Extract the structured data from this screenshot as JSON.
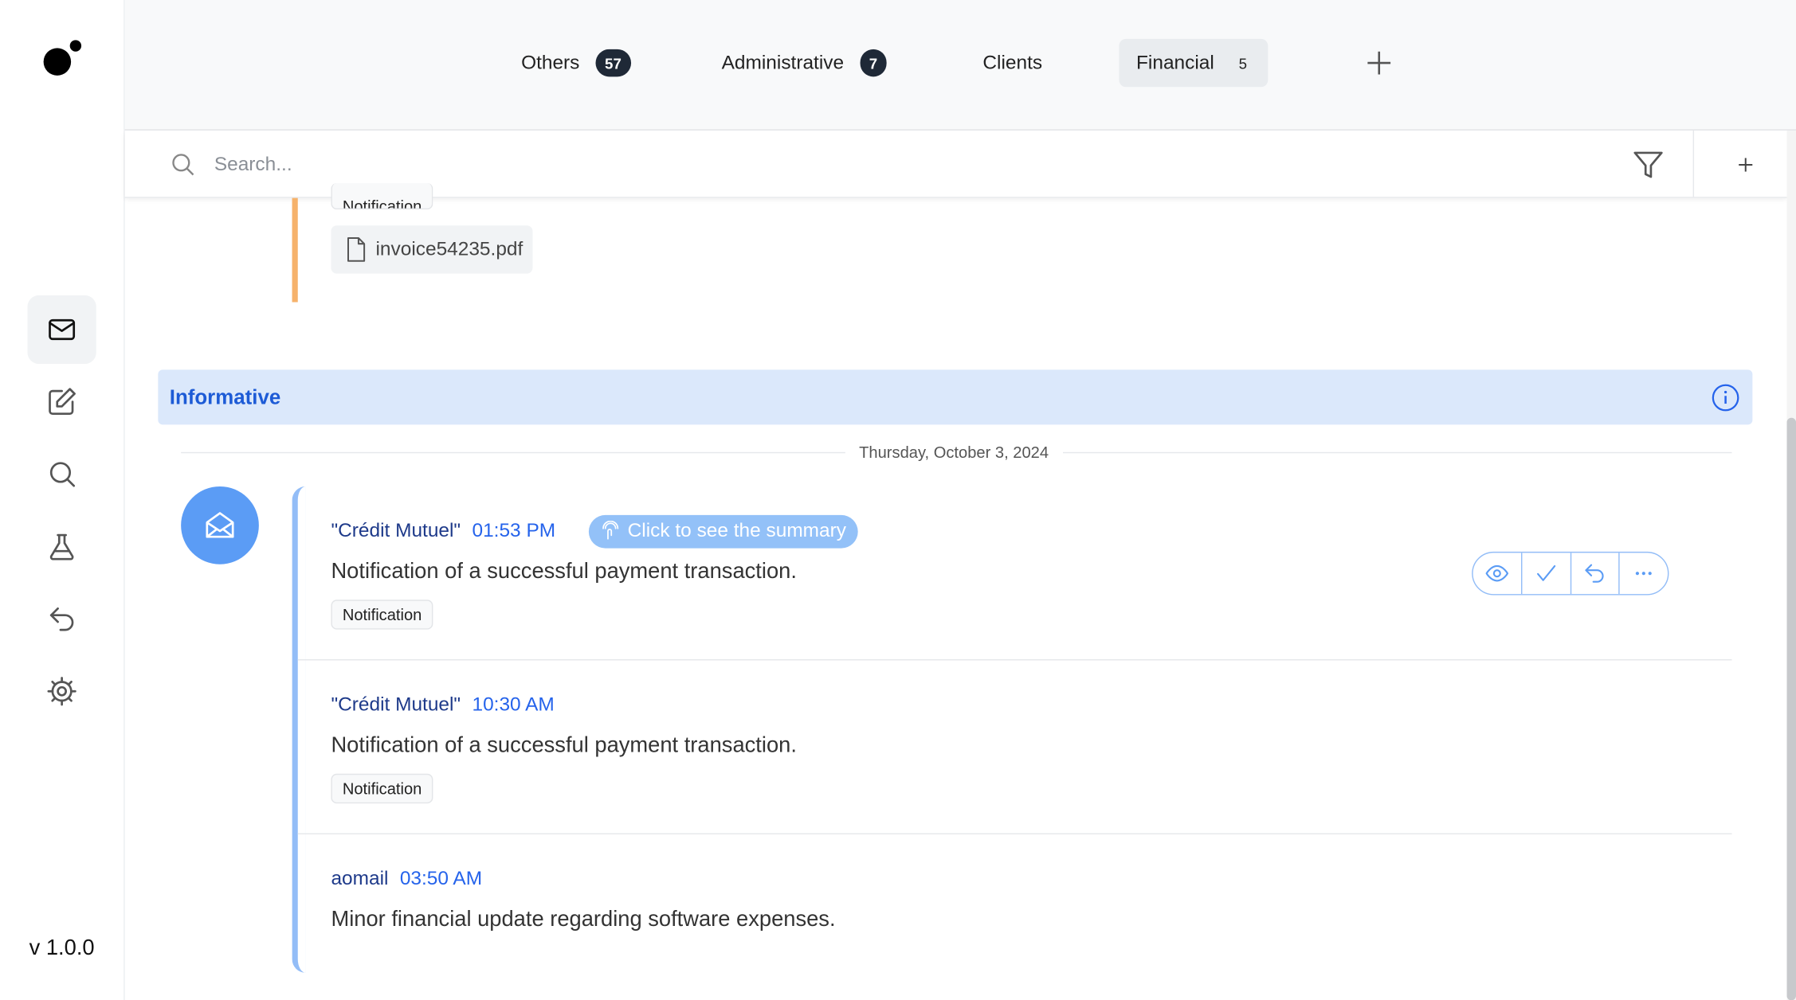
{
  "app": {
    "version": "v 1.0.0"
  },
  "sidebar": {
    "items": [
      {
        "icon": "mail-icon",
        "active": true
      },
      {
        "icon": "compose-icon"
      },
      {
        "icon": "search-icon"
      },
      {
        "icon": "flask-icon"
      },
      {
        "icon": "undo-icon"
      },
      {
        "icon": "settings-icon"
      }
    ]
  },
  "tabs": [
    {
      "label": "Others",
      "count": "57"
    },
    {
      "label": "Administrative",
      "count": "7"
    },
    {
      "label": "Clients",
      "count": ""
    },
    {
      "label": "Financial",
      "count": "5",
      "active": true
    }
  ],
  "search": {
    "placeholder": "Search..."
  },
  "previous": {
    "tag": "Notification",
    "attachment": "invoice54235.pdf",
    "accent": "#f6b26b"
  },
  "section": {
    "title": "Informative",
    "color": "#dbe8fb"
  },
  "date_divider": "Thursday, October 3, 2024",
  "messages": [
    {
      "sender": "\"Crédit Mutuel\"",
      "time": "01:53 PM",
      "summary": "Click to see the summary",
      "body": "Notification of a successful payment transaction.",
      "tag": "Notification"
    },
    {
      "sender": "\"Crédit Mutuel\"",
      "time": "10:30 AM",
      "body": "Notification of a successful payment transaction.",
      "tag": "Notification"
    },
    {
      "sender": "aomail",
      "time": "03:50 AM",
      "body": "Minor financial update regarding software expenses."
    }
  ],
  "colors": {
    "accent": "#5b9cf5",
    "badge": "#1f2937",
    "link": "#2563eb"
  }
}
